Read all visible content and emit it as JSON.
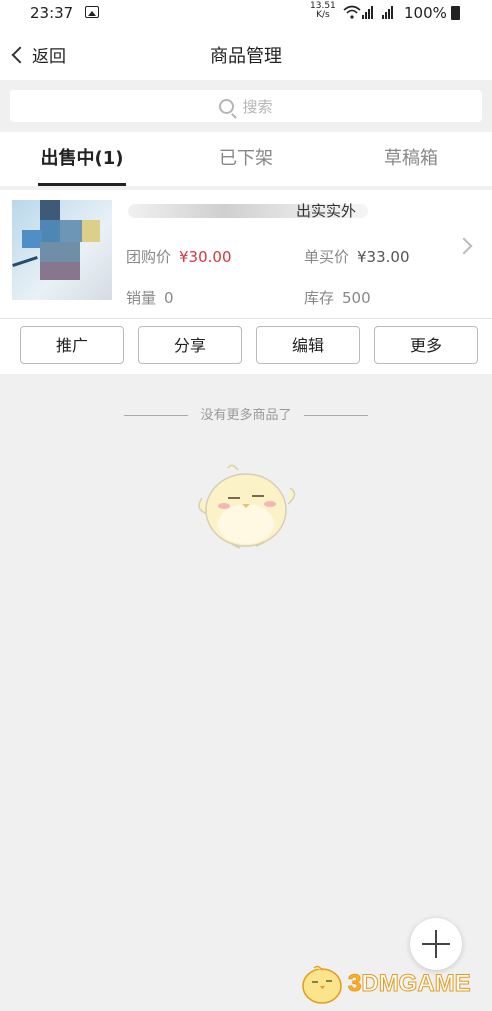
{
  "status_bar": {
    "time": "23:37",
    "net_speed_value": "13.51",
    "net_speed_unit": "K/s",
    "battery": "100%"
  },
  "nav": {
    "back_label": "返回",
    "title": "商品管理"
  },
  "search": {
    "placeholder": "搜索"
  },
  "tabs": [
    {
      "label": "出售中(1)",
      "active": true
    },
    {
      "label": "已下架",
      "active": false
    },
    {
      "label": "草稿箱",
      "active": false
    }
  ],
  "product": {
    "name_visible_tail": "出实实外",
    "group_price_label": "团购价",
    "group_price": "¥30.00",
    "single_price_label": "单买价",
    "single_price": "¥33.00",
    "sales_label": "销量",
    "sales": "0",
    "stock_label": "库存",
    "stock": "500"
  },
  "actions": {
    "promote": "推广",
    "share": "分享",
    "edit": "编辑",
    "more": "更多"
  },
  "empty_hint": "没有更多商品了",
  "watermark": {
    "text_prefix": "3",
    "text_rest": "DMGAME"
  },
  "colors": {
    "price_red": "#d9363e",
    "background": "#f0f0f1"
  }
}
